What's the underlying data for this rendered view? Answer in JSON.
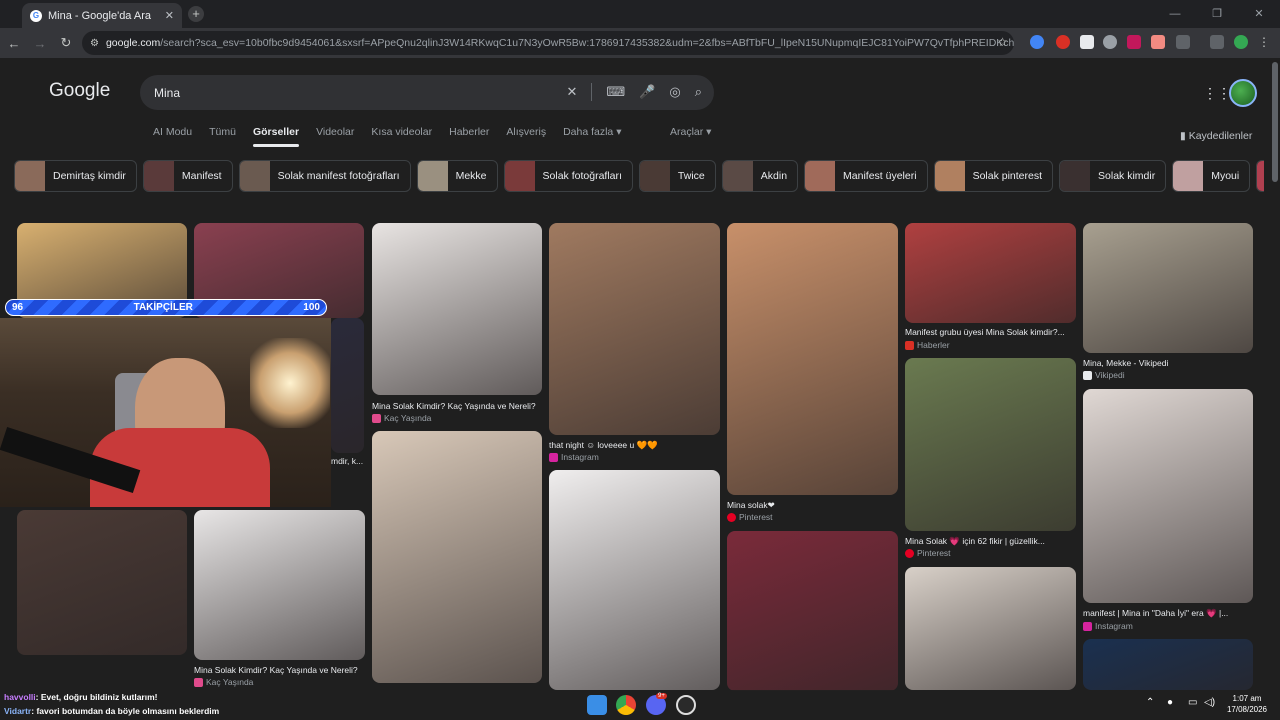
{
  "browser": {
    "tab_title": "Mina - Google'da Ara",
    "tab_close": "✕",
    "new_tab": "+",
    "url_domain": "google.com",
    "url_path": "/search?sca_esv=10b0fbc9d9454061&sxsrf=APpeQnu2qlinJ3W14RKwqC1u7N3yOwR5Bw:1786917435382&udm=2&fbs=ABfTbFU_lIpeN15UNupmqIEJC81YoiPW7QvTfphPREIDKchwKqQ8tvqmcXvTDZV4...",
    "window_buttons": [
      "—",
      "❐",
      "✕"
    ]
  },
  "google": {
    "logo": "Google",
    "query": "Mina",
    "tabs": [
      "AI Modu",
      "Tümü",
      "Görseller",
      "Videolar",
      "Kısa videolar",
      "Haberler",
      "Alışveriş",
      "Daha fazla ▾"
    ],
    "tools": "Araçlar ▾",
    "saved": "Kaydedilenler"
  },
  "chips": [
    {
      "label": "Demirtaş kimdir",
      "color": "#8a6a5a"
    },
    {
      "label": "Manifest",
      "color": "#5a3a3a"
    },
    {
      "label": "Solak manifest fotoğrafları",
      "color": "#6a5a50"
    },
    {
      "label": "Mekke",
      "color": "#9a9080"
    },
    {
      "label": "Solak fotoğrafları",
      "color": "#7a3a3a"
    },
    {
      "label": "Twice",
      "color": "#4a3a35"
    },
    {
      "label": "Akdin",
      "color": "#5a4a45"
    },
    {
      "label": "Manifest üyeleri",
      "color": "#a06a5a"
    },
    {
      "label": "Solak pinterest",
      "color": "#b08060"
    },
    {
      "label": "Solak kimdir",
      "color": "#3a3030"
    },
    {
      "label": "Myoui",
      "color": "#c0a0a0"
    },
    {
      "label": "",
      "color": "#b04050"
    }
  ],
  "results": {
    "r1": {
      "caption": "",
      "source": "",
      "color": "#d8b070"
    },
    "r2": {
      "caption": "",
      "source": "",
      "color": "#8a4050"
    },
    "r2b": {
      "caption": "mdir, k...",
      "source": "",
      "color": "#2a2a3a"
    },
    "r3": {
      "caption": "Mina Solak Kimdir? Kaç Yaşında ve Nereli?",
      "source": "Kaç Yaşında",
      "color": "#e8e4e2"
    },
    "r4": {
      "caption": "that night ☺ loveeee u 🧡🧡",
      "source": "Instagram",
      "color": "#a07a60"
    },
    "r5": {
      "caption": "Mina solak❤",
      "source": "Pinterest",
      "color": "#c8906a"
    },
    "r6": {
      "caption": "Manifest grubu üyesi Mina Solak kimdir?...",
      "source": "Haberler",
      "color": "#b04040"
    },
    "r7": {
      "caption": "Mina, Mekke - Vikipedi",
      "source": "Vikipedi",
      "color": "#a8a090"
    },
    "r8": {
      "caption": "Mina Solak 💗 için 62 fikir | güzellik...",
      "source": "Pinterest",
      "color": "#6a7a50"
    },
    "r9": {
      "caption": "manifest | Mina in \"Daha İyi\" era 💗 |...",
      "source": "Instagram",
      "color": "#e0d8d4"
    },
    "r10": {
      "caption": "",
      "source": "",
      "color": "#d8c8b8"
    },
    "r11": {
      "caption": "",
      "source": "",
      "color": "#f0eeee"
    },
    "r12": {
      "caption": "",
      "source": "",
      "color": "#7a2a3a"
    },
    "r13": {
      "caption": "",
      "source": "",
      "color": "#d8d0c8"
    },
    "r14": {
      "caption": "",
      "source": "",
      "color": "#1a3050"
    },
    "r15": {
      "caption": "",
      "source": "",
      "color": "#4a3a35"
    },
    "r16": {
      "caption": "Mina Solak Kimdir? Kaç Yaşında ve Nereli?",
      "source": "Kaç Yaşında",
      "color": "#e8e6e6"
    }
  },
  "overlay": {
    "follow_left": "96",
    "follow_label": "TAKİPÇİLER",
    "follow_right": "100",
    "follow_progress": 0.96,
    "chat": [
      {
        "user": "havvolli",
        "text": ": Evet, doğru bildiniz kutlarım!",
        "color": "#c77dff"
      },
      {
        "user": "Vidartr",
        "text": ": favori botumdan da böyle olmasını beklerdim",
        "color": "#8ab4f8"
      }
    ]
  },
  "taskbar": {
    "time": "1:07 am",
    "date": "17/08/2026",
    "badge": "9+"
  }
}
